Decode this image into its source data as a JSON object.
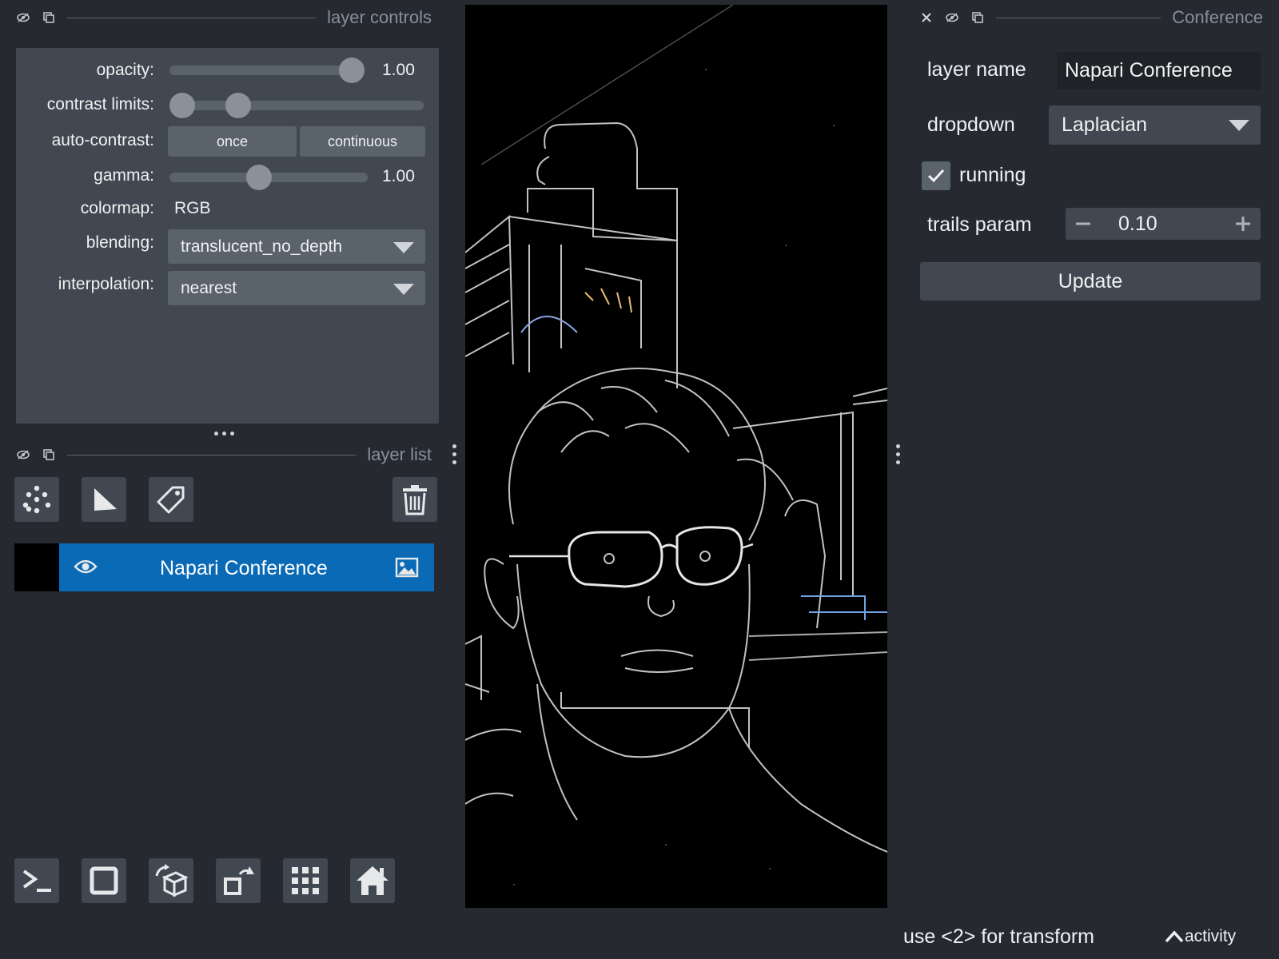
{
  "layer_controls_dock": {
    "title": "layer controls",
    "opacity_label": "opacity:",
    "opacity_value": 1.0,
    "opacity_text": "1.00",
    "contrast_limits_label": "contrast limits:",
    "contrast_limits_range": [
      0.0,
      0.27
    ],
    "auto_contrast_label": "auto-contrast:",
    "auto_contrast_once": "once",
    "auto_contrast_continuous": "continuous",
    "gamma_label": "gamma:",
    "gamma_value": 0.5,
    "gamma_text": "1.00",
    "colormap_label": "colormap:",
    "colormap_value": "RGB",
    "blending_label": "blending:",
    "blending_value": "translucent_no_depth",
    "interpolation_label": "interpolation:",
    "interpolation_value": "nearest"
  },
  "layer_list_dock": {
    "title": "layer list",
    "layers": [
      {
        "name": "Napari Conference",
        "visible": true,
        "selected": true
      }
    ]
  },
  "conference_widget": {
    "title": "Conference",
    "layer_name_label": "layer name",
    "layer_name_value": "Napari Conference",
    "dropdown_label": "dropdown",
    "dropdown_value": "Laplacian",
    "running_label": "running",
    "running_checked": true,
    "trails_param_label": "trails param",
    "trails_param_value": "0.10",
    "update_label": "Update"
  },
  "status_bar": {
    "message": "use <2> for transform",
    "activity_label": "activity"
  },
  "colors": {
    "background": "#262930",
    "panel": "#414851",
    "control": "#5a626c",
    "selected_layer": "#0a6ab5",
    "text": "#f0f1f2"
  }
}
